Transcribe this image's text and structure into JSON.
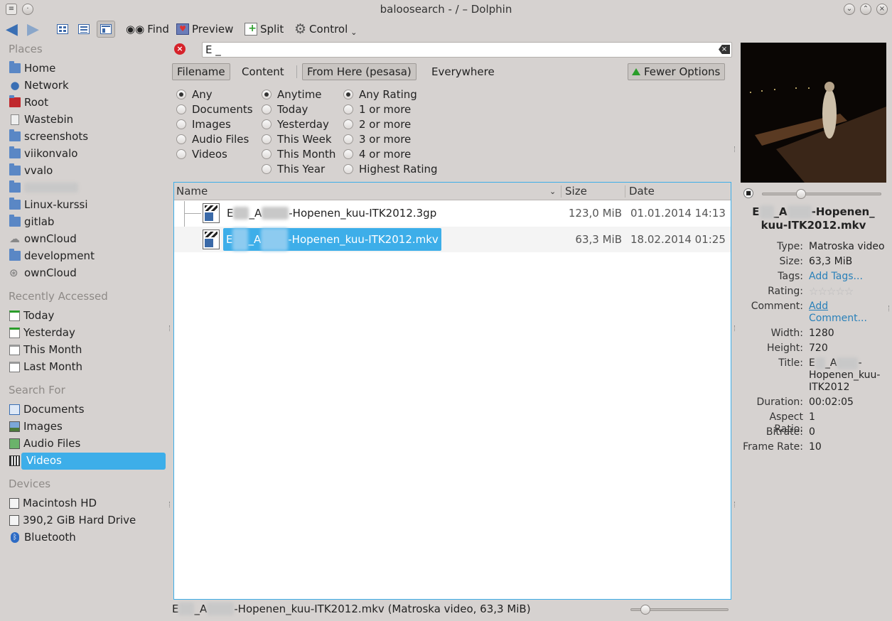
{
  "window": {
    "title": "baloosearch - / – Dolphin"
  },
  "toolbar": {
    "find": "Find",
    "preview": "Preview",
    "split": "Split",
    "control": "Control"
  },
  "places": {
    "sections": {
      "places": "Places",
      "recent": "Recently Accessed",
      "search": "Search For",
      "devices": "Devices"
    },
    "items": [
      "Home",
      "Network",
      "Root",
      "Wastebin",
      "screenshots",
      "viikonvalo",
      "vvalo",
      "",
      "Linux-kurssi",
      "gitlab",
      "ownCloud",
      "development",
      "ownCloud"
    ],
    "recent": [
      "Today",
      "Yesterday",
      "This Month",
      "Last Month"
    ],
    "search": [
      "Documents",
      "Images",
      "Audio Files",
      "Videos"
    ],
    "devices": [
      "Macintosh HD",
      "390,2 GiB Hard Drive",
      "Bluetooth"
    ]
  },
  "search": {
    "query": "E _",
    "chips": {
      "filename": "Filename",
      "content": "Content",
      "from_here": "From Here (pesasa)",
      "everywhere": "Everywhere",
      "fewer": "Fewer Options"
    },
    "types": [
      "Any",
      "Documents",
      "Images",
      "Audio Files",
      "Videos"
    ],
    "dates": [
      "Anytime",
      "Today",
      "Yesterday",
      "This Week",
      "This Month",
      "This Year"
    ],
    "ratings": [
      "Any Rating",
      "1 or more",
      "2 or more",
      "3 or more",
      "4 or more",
      "Highest Rating"
    ]
  },
  "filelist": {
    "headers": {
      "name": "Name",
      "size": "Size",
      "date": "Date"
    },
    "rows": [
      {
        "name_a": "E",
        "name_b": "_A",
        "name_c": "-Hopenen_kuu-ITK2012.3gp",
        "size": "123,0 MiB",
        "date": "01.01.2014 14:13"
      },
      {
        "name_a": "E",
        "name_b": "_A",
        "name_c": "-Hopenen_kuu-ITK2012.mkv",
        "size": "63,3 MiB",
        "date": "18.02.2014 01:25"
      }
    ]
  },
  "status": {
    "a": "E",
    "b": "_A",
    "c": "-Hopenen_kuu-ITK2012.mkv (Matroska video, 63,3 MiB)"
  },
  "info": {
    "name_a": "E",
    "name_b": "_A",
    "name_c": "-Hopenen_",
    "name_d": "kuu-ITK2012.mkv",
    "labels": {
      "type": "Type:",
      "size": "Size:",
      "tags": "Tags:",
      "rating": "Rating:",
      "comment": "Comment:",
      "width": "Width:",
      "height": "Height:",
      "title": "Title:",
      "duration": "Duration:",
      "aspect": "Aspect Ratio:",
      "bitrate": "Bitrate:",
      "framerate": "Frame Rate:"
    },
    "type": "Matroska video",
    "size": "63,3 MiB",
    "tags": "Add Tags...",
    "rating_stars": "☆☆☆☆☆",
    "comment_1": "Add",
    "comment_2": "Comment...",
    "width": "1280",
    "height": "720",
    "title_1": "E",
    "title_1b": "_A",
    "title_1c": "-",
    "title_2": "Hopenen_kuu-",
    "title_3": "ITK2012",
    "duration": "00:02:05",
    "aspect": "1",
    "bitrate": "0",
    "framerate": "10"
  }
}
